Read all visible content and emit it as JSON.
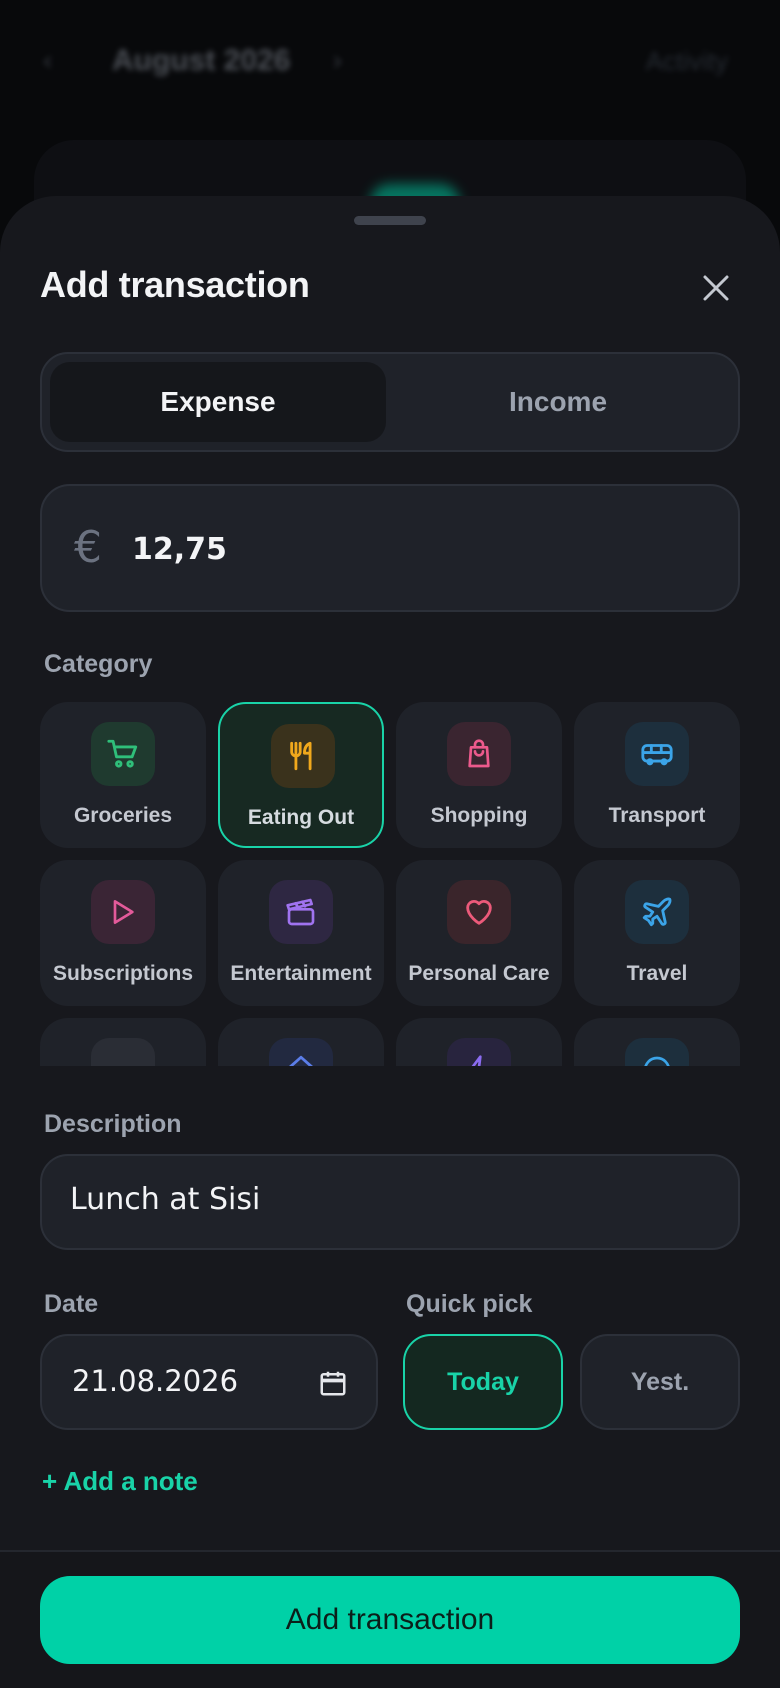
{
  "background": {
    "month": "August 2026",
    "activity_link": "Activity"
  },
  "sheet": {
    "title": "Add transaction",
    "type_toggle": {
      "expense": "Expense",
      "income": "Income",
      "selected": "Expense"
    },
    "amount": {
      "currency_symbol": "€",
      "value": "12,75"
    },
    "category_label": "Category",
    "categories": [
      {
        "label": "Groceries",
        "icon": "cart-icon",
        "color": "#2fbf7a"
      },
      {
        "label": "Eating Out",
        "icon": "utensils-icon",
        "color": "#f0a81c",
        "selected": true
      },
      {
        "label": "Shopping",
        "icon": "shopping-bag-icon",
        "color": "#ec5a8c"
      },
      {
        "label": "Transport",
        "icon": "bus-icon",
        "color": "#3ba4e8"
      },
      {
        "label": "Subscriptions",
        "icon": "play-icon",
        "color": "#e35a9a"
      },
      {
        "label": "Entertainment",
        "icon": "clapperboard-icon",
        "color": "#a073f0"
      },
      {
        "label": "Personal Care",
        "icon": "heart-icon",
        "color": "#ec5a7a"
      },
      {
        "label": "Travel",
        "icon": "plane-icon",
        "color": "#3ba4e8"
      }
    ],
    "description_label": "Description",
    "description_value": "Lunch at Sisi",
    "date_label": "Date",
    "date_value": "21.08.2026",
    "quick_pick_label": "Quick pick",
    "quick_today": "Today",
    "quick_yest": "Yest.",
    "add_note": "+ Add a note",
    "submit": "Add transaction"
  },
  "colors": {
    "accent": "#00d1a7",
    "sheet_bg": "#17181d",
    "card_bg": "#1f2229"
  }
}
